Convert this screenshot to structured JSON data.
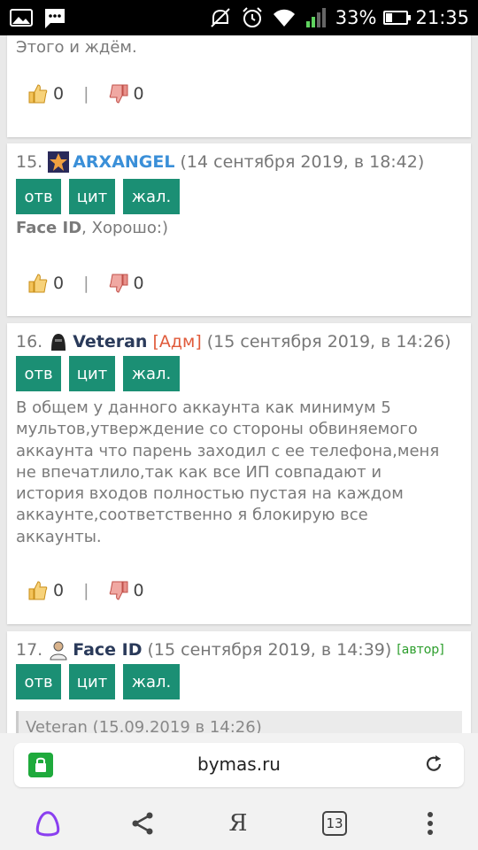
{
  "status": {
    "battery": "33%",
    "time": "21:35",
    "battery_level": 0.33
  },
  "partial_post": {
    "text": "Этого и ждём.",
    "likes": "0",
    "dislikes": "0"
  },
  "posts": [
    {
      "num": "15.",
      "user": "ARXANGEL",
      "role": "",
      "date": "(14 сентября 2019, в 18:42)",
      "buttons": [
        "отв",
        "цит",
        "жал."
      ],
      "text_bold": "Face ID",
      "text": ", Хорошо:)",
      "likes": "0",
      "dislikes": "0"
    },
    {
      "num": "16.",
      "user": "Veteran",
      "role": "[Адм]",
      "date": "(15 сентября 2019, в 14:26)",
      "buttons": [
        "отв",
        "цит",
        "жал."
      ],
      "text_lines": [
        "В общем у данного аккаунта как минимум 5",
        "мультов,утверждение со стороны обвиняемого",
        "аккаунта что парень заходил с ее телефона,меня",
        "не впечатлило,так как все ИП совпадают и",
        "история входов полностью пустая на каждом",
        "аккаунте,соответственно я блокирую все",
        "аккаунты."
      ],
      "likes": "0",
      "dislikes": "0"
    },
    {
      "num": "17.",
      "user": "Face ID",
      "date": "(15 сентября 2019, в 14:39)",
      "author": "[автор]",
      "buttons": [
        "отв",
        "цит",
        "жал."
      ],
      "quote": "Veteran (15.09.2019 в 14:26)"
    }
  ],
  "address_bar": {
    "url": "bymas.ru"
  },
  "bottom_nav": {
    "tabs_count": "13",
    "yandex_label": "Я"
  },
  "icons": [
    "gallery-icon",
    "message-icon",
    "mute-icon",
    "alarm-icon",
    "wifi-icon",
    "signal-icon",
    "battery-icon",
    "lock-icon",
    "reload-icon",
    "alice-icon",
    "share-icon",
    "yandex-icon",
    "tabs-icon",
    "menu-icon",
    "thumb-up-icon",
    "thumb-down-icon"
  ],
  "colors": {
    "button": "#1b8f74",
    "username_blue": "#3a8fd8",
    "admin_role": "#e05a3a",
    "author_tag": "#2a9d2a",
    "lock": "#1faa3c",
    "alice": "#8a3ff0"
  }
}
